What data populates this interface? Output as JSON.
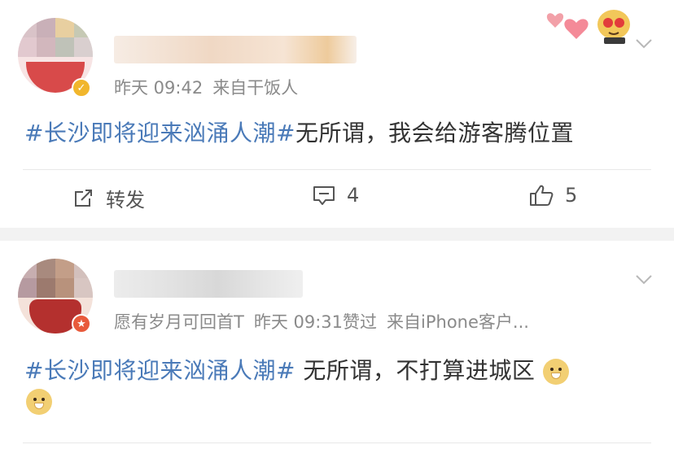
{
  "posts": [
    {
      "time": "昨天 09:42",
      "source": "来自干饭人",
      "hashtag": "#长沙即将迎来汹涌人潮#",
      "text": "无所谓，我会给游客腾位置",
      "actions": {
        "repost_label": "转发",
        "comment_count": "4",
        "like_count": "5"
      }
    },
    {
      "meta_extra": "愿有岁月可回首T",
      "time": "昨天 09:31赞过",
      "source": "来自iPhone客户...",
      "hashtag": "#长沙即将迎来汹涌人潮#",
      "text": " 无所谓，不打算进城区"
    }
  ],
  "colors": {
    "hashtag": "#4a7ab8",
    "meta": "#8a8a8a",
    "verify_gold": "#f1b62c",
    "verify_red": "#e85a3b"
  },
  "icons": [
    "chevron-down-icon",
    "repost-icon",
    "comment-icon",
    "like-icon",
    "verified-badge-icon",
    "doge-emoji-icon",
    "hearts-sticker-icon"
  ]
}
